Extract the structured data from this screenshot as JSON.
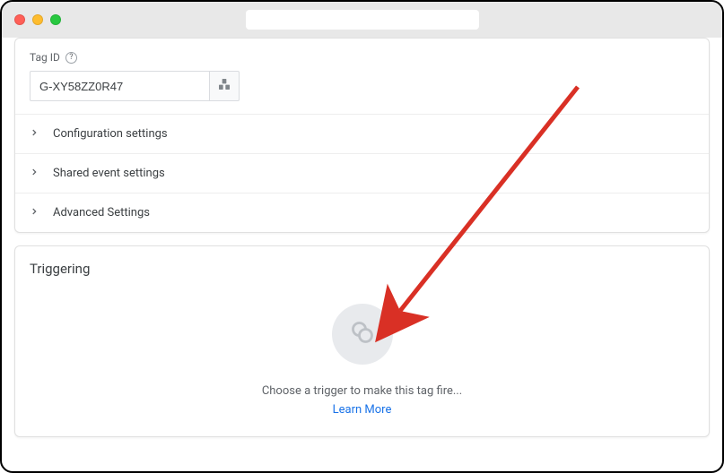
{
  "tagIdLabel": "Tag ID",
  "tagIdValue": "G-XY58ZZ0R47",
  "sections": {
    "config": "Configuration settings",
    "shared": "Shared event settings",
    "advanced": "Advanced Settings"
  },
  "triggeringTitle": "Triggering",
  "triggerPrompt": "Choose a trigger to make this tag fire...",
  "learnMore": "Learn More"
}
